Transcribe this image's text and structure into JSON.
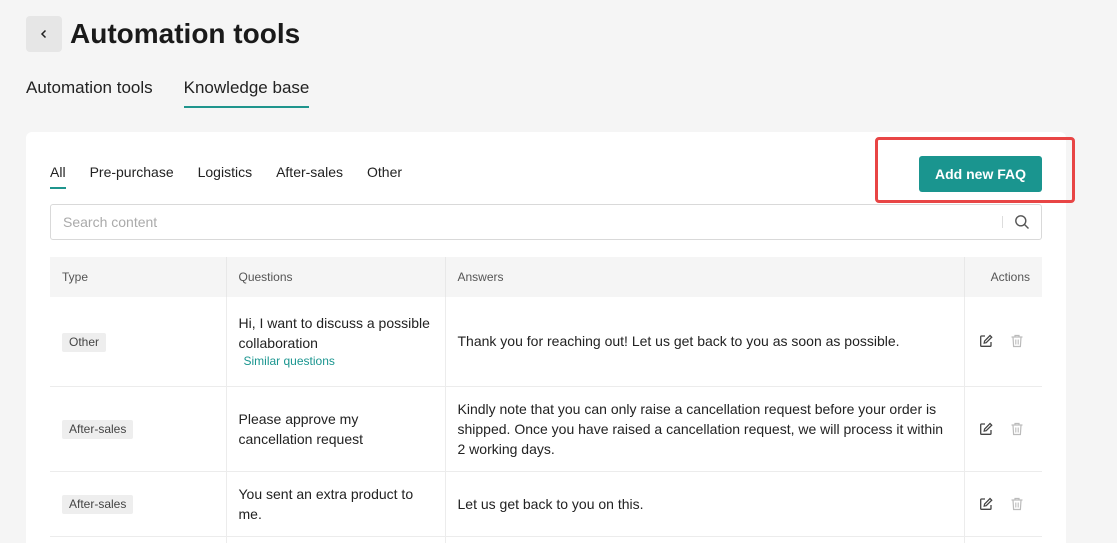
{
  "header": {
    "title": "Automation tools",
    "back_icon": "chevron-left-icon"
  },
  "top_tabs": [
    {
      "label": "Automation tools",
      "active": false
    },
    {
      "label": "Knowledge base",
      "active": true
    }
  ],
  "category_tabs": [
    {
      "label": "All",
      "active": true
    },
    {
      "label": "Pre-purchase",
      "active": false
    },
    {
      "label": "Logistics",
      "active": false
    },
    {
      "label": "After-sales",
      "active": false
    },
    {
      "label": "Other",
      "active": false
    }
  ],
  "add_button": {
    "label": "Add new FAQ"
  },
  "search": {
    "placeholder": "Search content",
    "value": "",
    "icon": "search-icon"
  },
  "table": {
    "columns": [
      "Type",
      "Questions",
      "Answers",
      "Actions"
    ],
    "rows": [
      {
        "type": "Other",
        "question": "Hi, I want to discuss a possible collaboration",
        "similar": "Similar questions",
        "answer": "Thank you for reaching out! Let us get back to you as soon as possible."
      },
      {
        "type": "After-sales",
        "question": "Please approve my cancellation request",
        "similar": "",
        "answer": "Kindly note that you can only raise a cancellation request before your order is shipped. Once you have raised a cancellation request, we will process it within 2 working days."
      },
      {
        "type": "After-sales",
        "question": "You sent an extra product to me.",
        "similar": "",
        "answer": "Let us get back to you on this."
      }
    ]
  },
  "colors": {
    "accent": "#1a958f",
    "highlight": "#e84545",
    "background": "#f5f5f5"
  }
}
